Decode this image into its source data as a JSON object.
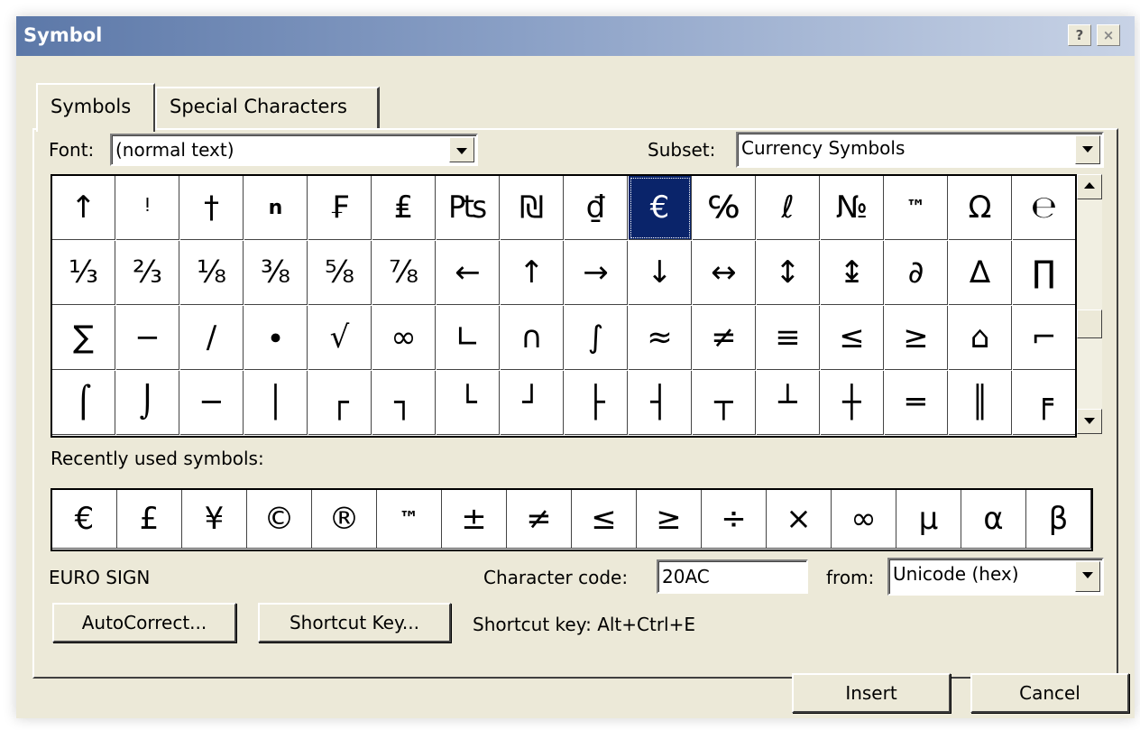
{
  "window": {
    "title": "Symbol"
  },
  "titlebar": {
    "help_label": "?",
    "close_label": "×"
  },
  "tabs": [
    {
      "label": "Symbols",
      "selected": true
    },
    {
      "label": "Special Characters",
      "selected": false
    }
  ],
  "font": {
    "label": "Font:",
    "value": "(normal text)"
  },
  "subset": {
    "label": "Subset:",
    "value": "Currency Symbols"
  },
  "grid": {
    "rows": [
      [
        "↑",
        "ᵎ",
        "†",
        "n",
        "₣",
        "₤",
        "₧",
        "₪",
        "₫",
        "€",
        "℅",
        "ℓ",
        "№",
        "™",
        "Ω",
        "℮"
      ],
      [
        "⅓",
        "⅔",
        "⅛",
        "⅜",
        "⅝",
        "⅞",
        "←",
        "↑",
        "→",
        "↓",
        "↔",
        "↕",
        "↨",
        "∂",
        "∆",
        "∏"
      ],
      [
        "∑",
        "−",
        "∕",
        "∙",
        "√",
        "∞",
        "∟",
        "∩",
        "∫",
        "≈",
        "≠",
        "≡",
        "≤",
        "≥",
        "⌂",
        "⌐"
      ],
      [
        "⌠",
        "⌡",
        "─",
        "│",
        "┌",
        "┐",
        "└",
        "┘",
        "├",
        "┤",
        "┬",
        "┴",
        "┼",
        "═",
        "║",
        "╒"
      ]
    ],
    "selected": {
      "row": 0,
      "col": 9
    }
  },
  "recent": {
    "label": "Recently used symbols:",
    "symbols": [
      "€",
      "£",
      "¥",
      "©",
      "®",
      "™",
      "±",
      "≠",
      "≤",
      "≥",
      "÷",
      "×",
      "∞",
      "µ",
      "α",
      "β"
    ]
  },
  "char_name": "EURO SIGN",
  "char_code": {
    "label": "Character code:",
    "value": "20AC"
  },
  "from": {
    "label": "from:",
    "value": "Unicode (hex)"
  },
  "buttons": {
    "autocorrect": "AutoCorrect...",
    "shortcut_key": "Shortcut Key...",
    "insert": "Insert",
    "cancel": "Cancel"
  },
  "shortcut_text": "Shortcut key: Alt+Ctrl+E"
}
